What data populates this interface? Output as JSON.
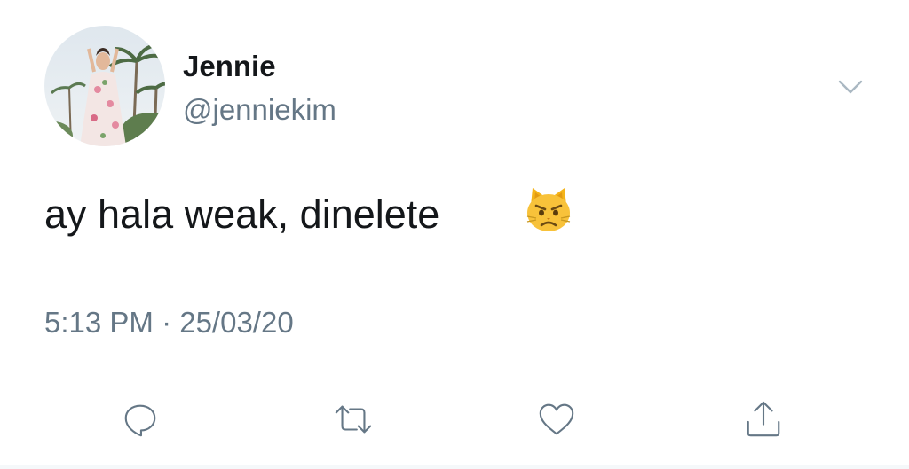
{
  "author": {
    "name": "Jennie",
    "handle": "@jenniekim",
    "avatar_icon": "profile-photo"
  },
  "tweet": {
    "text": "ay hala weak, dinelete",
    "emoji_icon": "pouting-cat-face",
    "timestamp": "5:13 PM · 25/03/20"
  },
  "menu": {
    "icon": "chevron-down-icon"
  },
  "actions": [
    {
      "name": "reply",
      "icon": "speech-bubble-icon"
    },
    {
      "name": "retweet",
      "icon": "retweet-icon"
    },
    {
      "name": "like",
      "icon": "heart-icon"
    },
    {
      "name": "share",
      "icon": "share-icon"
    }
  ],
  "colors": {
    "primary_text": "#14171a",
    "secondary_text": "#657786",
    "divider": "#e1e8ed"
  }
}
